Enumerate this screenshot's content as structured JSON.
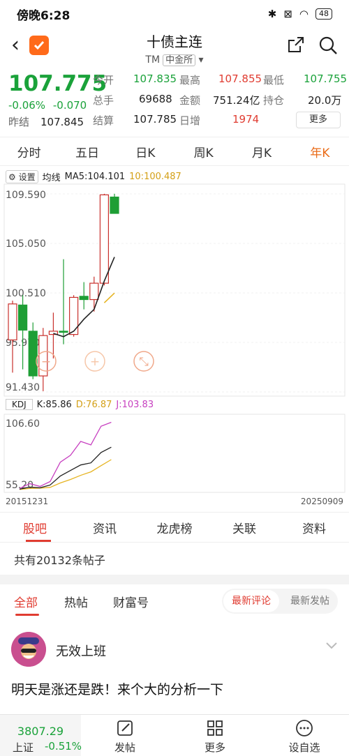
{
  "status": {
    "time": "傍晚6:28",
    "battery": "48"
  },
  "header": {
    "title": "十债主连",
    "code": "TM",
    "exchange": "中金所"
  },
  "quote": {
    "price": "107.775",
    "change_pct": "-0.06%",
    "change": "-0.070",
    "prev_close_label": "昨结",
    "prev_close": "107.845",
    "rows": [
      [
        {
          "label": "今开",
          "value": "107.835",
          "color": "green"
        },
        {
          "label": "最高",
          "value": "107.855",
          "color": "red"
        },
        {
          "label": "最低",
          "value": "107.755",
          "color": "green"
        }
      ],
      [
        {
          "label": "总手",
          "value": "69688",
          "color": "black"
        },
        {
          "label": "金额",
          "value": "751.24亿",
          "color": "black"
        },
        {
          "label": "持仓",
          "value": "20.0万",
          "color": "black"
        }
      ],
      [
        {
          "label": "结算",
          "value": "107.785",
          "color": "black"
        },
        {
          "label": "日增",
          "value": "1974",
          "color": "red"
        }
      ]
    ],
    "more_label": "更多"
  },
  "period_tabs": [
    "分时",
    "五日",
    "日K",
    "周K",
    "月K",
    "年K"
  ],
  "chart_data": {
    "type": "candlestick",
    "ma_title": "均线",
    "ma5_label": "MA5:104.101",
    "ma10_label": "10:100.487",
    "settings_label": "设置",
    "y_ticks": [
      "109.590",
      "105.050",
      "100.510",
      "95.970",
      "91.430"
    ],
    "ylim": [
      91.43,
      109.59
    ],
    "candles": [
      {
        "o": 96.2,
        "h": 99.8,
        "l": 93.2,
        "c": 99.5,
        "up": true
      },
      {
        "o": 99.4,
        "h": 100.3,
        "l": 93.5,
        "c": 97.1,
        "up": false
      },
      {
        "o": 97.0,
        "h": 97.8,
        "l": 92.6,
        "c": 92.9,
        "up": false
      },
      {
        "o": 92.9,
        "h": 97.3,
        "l": 91.5,
        "c": 96.6,
        "up": true
      },
      {
        "o": 96.7,
        "h": 98.7,
        "l": 94.5,
        "c": 97.0,
        "up": true
      },
      {
        "o": 97.0,
        "h": 103.6,
        "l": 95.8,
        "c": 96.9,
        "up": false
      },
      {
        "o": 96.7,
        "h": 100.3,
        "l": 96.5,
        "c": 100.1,
        "up": true
      },
      {
        "o": 100.2,
        "h": 101.5,
        "l": 99.0,
        "c": 99.9,
        "up": false
      },
      {
        "o": 99.9,
        "h": 102.0,
        "l": 98.8,
        "c": 101.4,
        "up": true
      },
      {
        "o": 101.4,
        "h": 109.6,
        "l": 101.2,
        "c": 109.5,
        "up": true
      },
      {
        "o": 109.3,
        "h": 109.6,
        "l": 107.8,
        "c": 107.8,
        "up": false
      }
    ],
    "ma5": [
      null,
      null,
      null,
      null,
      96.8,
      96.5,
      97.0,
      98.1,
      99.0,
      101.6,
      103.8
    ],
    "ma10": [
      null,
      null,
      null,
      null,
      null,
      null,
      null,
      null,
      null,
      99.6,
      100.5
    ],
    "kdj_label": "KDJ",
    "k_label": "K:85.86",
    "d_label": "D:76.87",
    "j_label": "J:103.83",
    "kdj_ticks": [
      "106.60",
      "55.20"
    ],
    "kdj_ylim": [
      55.2,
      106.6
    ],
    "k": [
      55.5,
      57.0,
      56.5,
      58.5,
      65.0,
      69.0,
      73.0,
      74.5,
      82.0,
      85.86
    ],
    "d": [
      55.3,
      56.0,
      56.2,
      56.8,
      60.0,
      62.5,
      65.5,
      68.0,
      72.5,
      76.87
    ],
    "j": [
      56.0,
      59.5,
      57.5,
      61.0,
      75.0,
      80.0,
      90.0,
      87.5,
      101.0,
      103.83
    ],
    "date_start": "20151231",
    "date_end": "20250909",
    "colors": {
      "up": "#c9302c",
      "down": "#1e9e35",
      "ma5": "#222222",
      "ma10": "#e6b422",
      "k": "#222222",
      "d": "#e6b422",
      "j": "#c740c0"
    }
  },
  "info_tabs": [
    "股吧",
    "资讯",
    "龙虎榜",
    "关联",
    "资料"
  ],
  "post_count": "共有20132条帖子",
  "filter_tabs": [
    "全部",
    "热帖",
    "财富号"
  ],
  "sort_tabs": [
    "最新评论",
    "最新发帖"
  ],
  "post": {
    "user": "无效上班",
    "text": "明天是涨还是跌！来个大的分析一下"
  },
  "bottom": {
    "index_value": "3807.29",
    "index_name": "上证",
    "index_change": "-0.51%",
    "post_label": "发帖",
    "more_label": "更多",
    "watch_label": "设自选"
  }
}
